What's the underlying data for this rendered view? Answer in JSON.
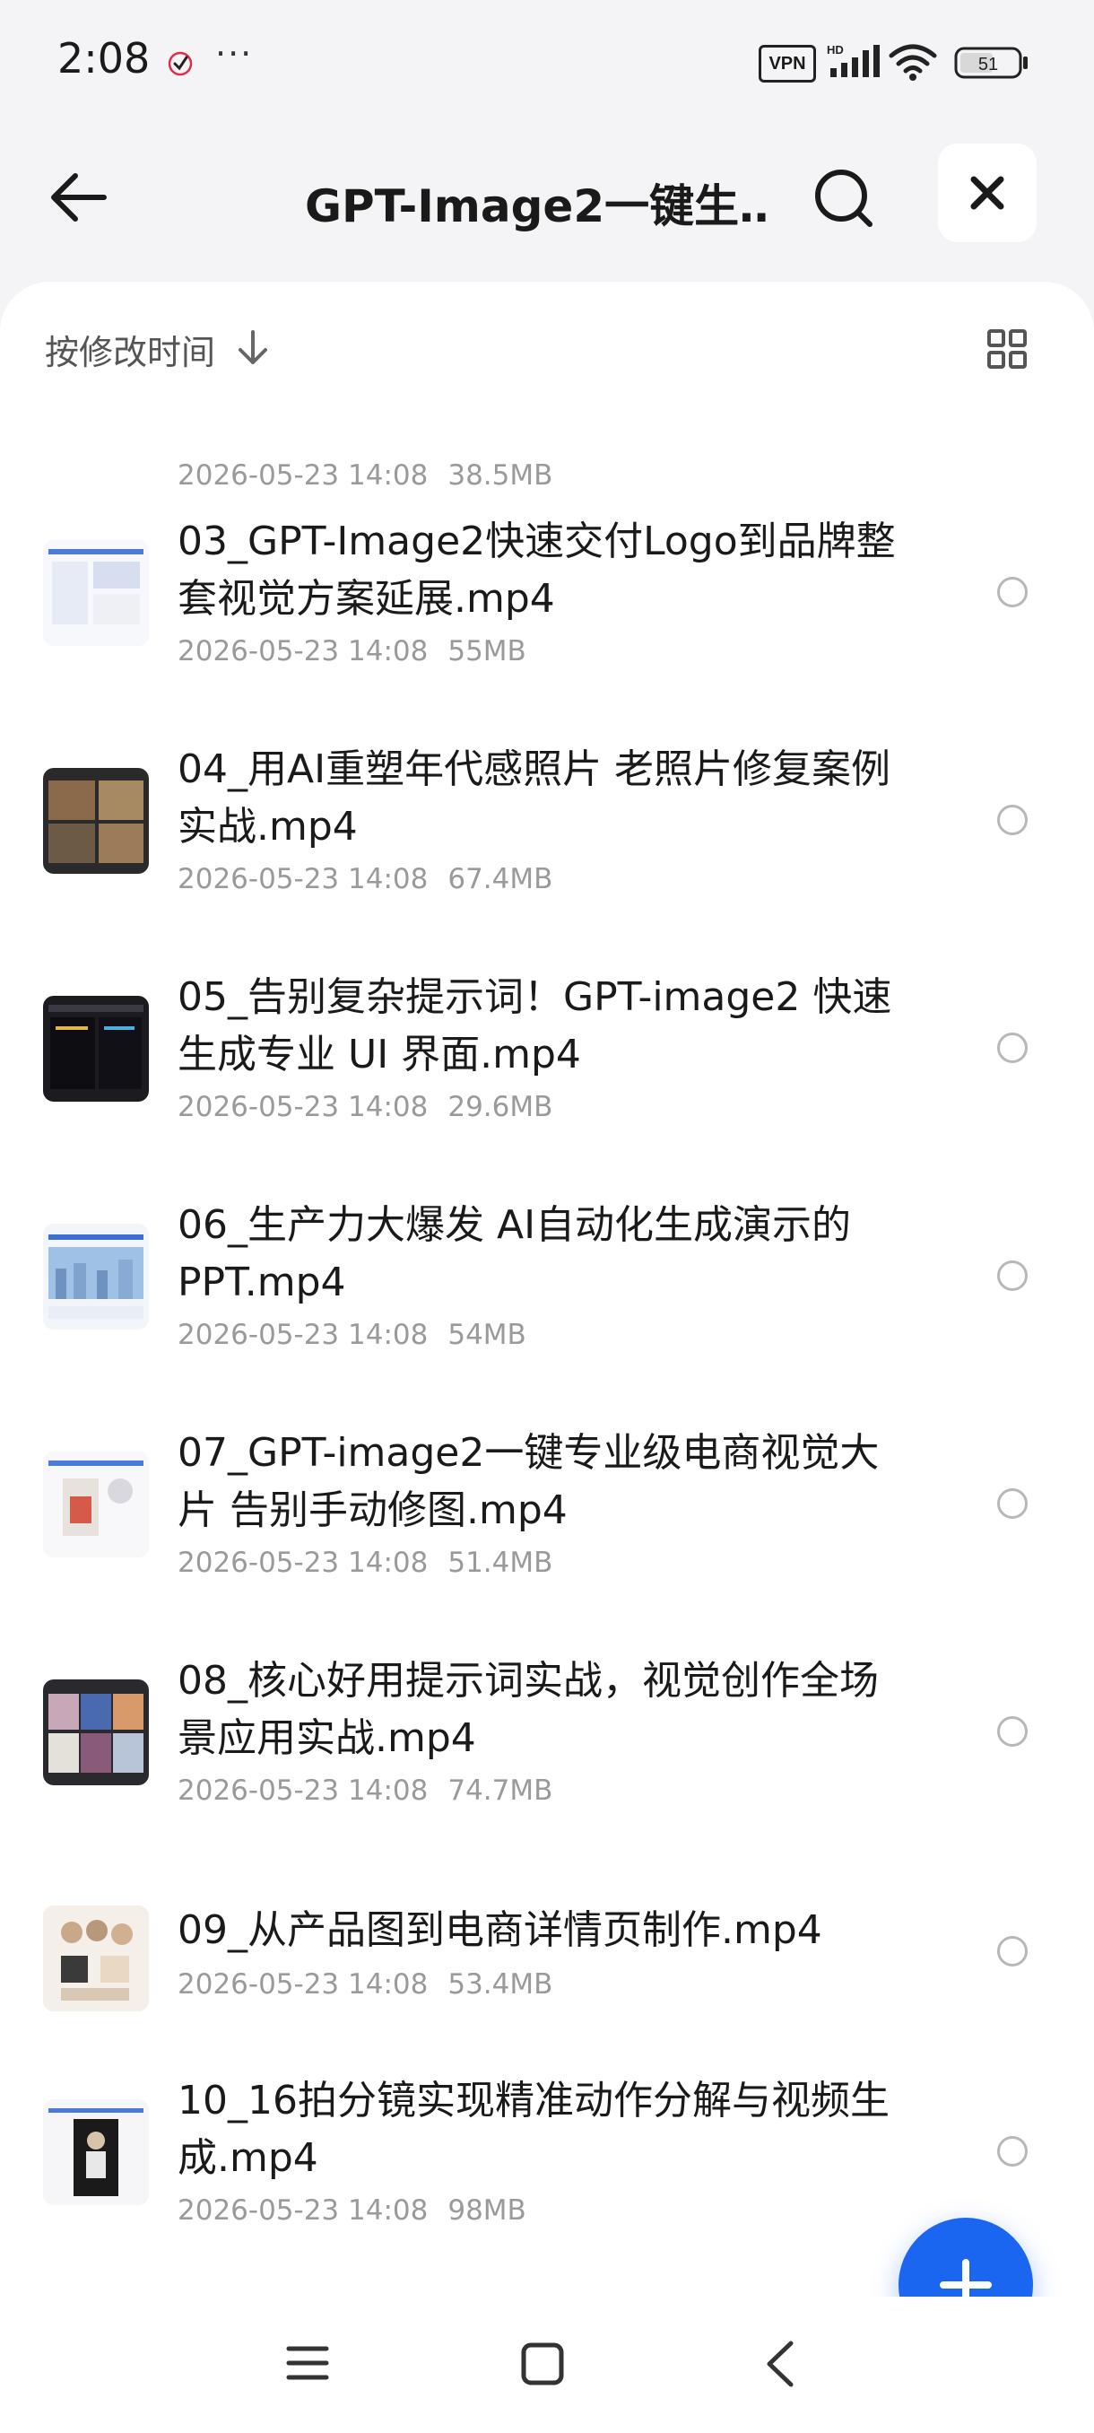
{
  "status_bar": {
    "time": "2:08",
    "more": "···",
    "vpn": "VPN",
    "signal_tag": "HD",
    "battery": "51"
  },
  "header": {
    "title": "GPT-Image2一键生…",
    "back_icon": "arrow-left-icon",
    "search_icon": "search-icon",
    "close_icon": "close-icon"
  },
  "sort_bar": {
    "label": "按修改时间",
    "arrow_icon": "arrow-down-icon",
    "view_icon": "grid-view-icon"
  },
  "files": [
    {
      "title": "",
      "date": "2026-05-23 14:08",
      "size": "38.5MB"
    },
    {
      "title": "03_GPT-Image2快速交付Logo到品牌整套视觉方案延展.mp4",
      "date": "2026-05-23 14:08",
      "size": "55MB"
    },
    {
      "title": "04_用AI重塑年代感照片 老照片修复案例实战.mp4",
      "date": "2026-05-23 14:08",
      "size": "67.4MB"
    },
    {
      "title": "05_告别复杂提示词！GPT-image2 快速生成专业 UI 界面.mp4",
      "date": "2026-05-23 14:08",
      "size": "29.6MB"
    },
    {
      "title": "06_生产力大爆发 AI自动化生成演示的PPT.mp4",
      "date": "2026-05-23 14:08",
      "size": "54MB"
    },
    {
      "title": "07_GPT-image2一键专业级电商视觉大片 告别手动修图.mp4",
      "date": "2026-05-23 14:08",
      "size": "51.4MB"
    },
    {
      "title": "08_核心好用提示词实战，视觉创作全场景应用实战.mp4",
      "date": "2026-05-23 14:08",
      "size": "74.7MB"
    },
    {
      "title": "09_从产品图到电商详情页制作.mp4",
      "date": "2026-05-23 14:08",
      "size": "53.4MB"
    },
    {
      "title": "10_16拍分镜实现精准动作分解与视频生成.mp4",
      "date": "2026-05-23 14:08",
      "size": "98MB"
    }
  ],
  "fab": {
    "icon": "plus-icon"
  },
  "nav": {
    "menu_icon": "menu-icon",
    "home_icon": "home-icon",
    "back_icon": "nav-back-icon"
  },
  "colors": {
    "accent": "#1a66f0",
    "meta": "#9a9a9a"
  }
}
